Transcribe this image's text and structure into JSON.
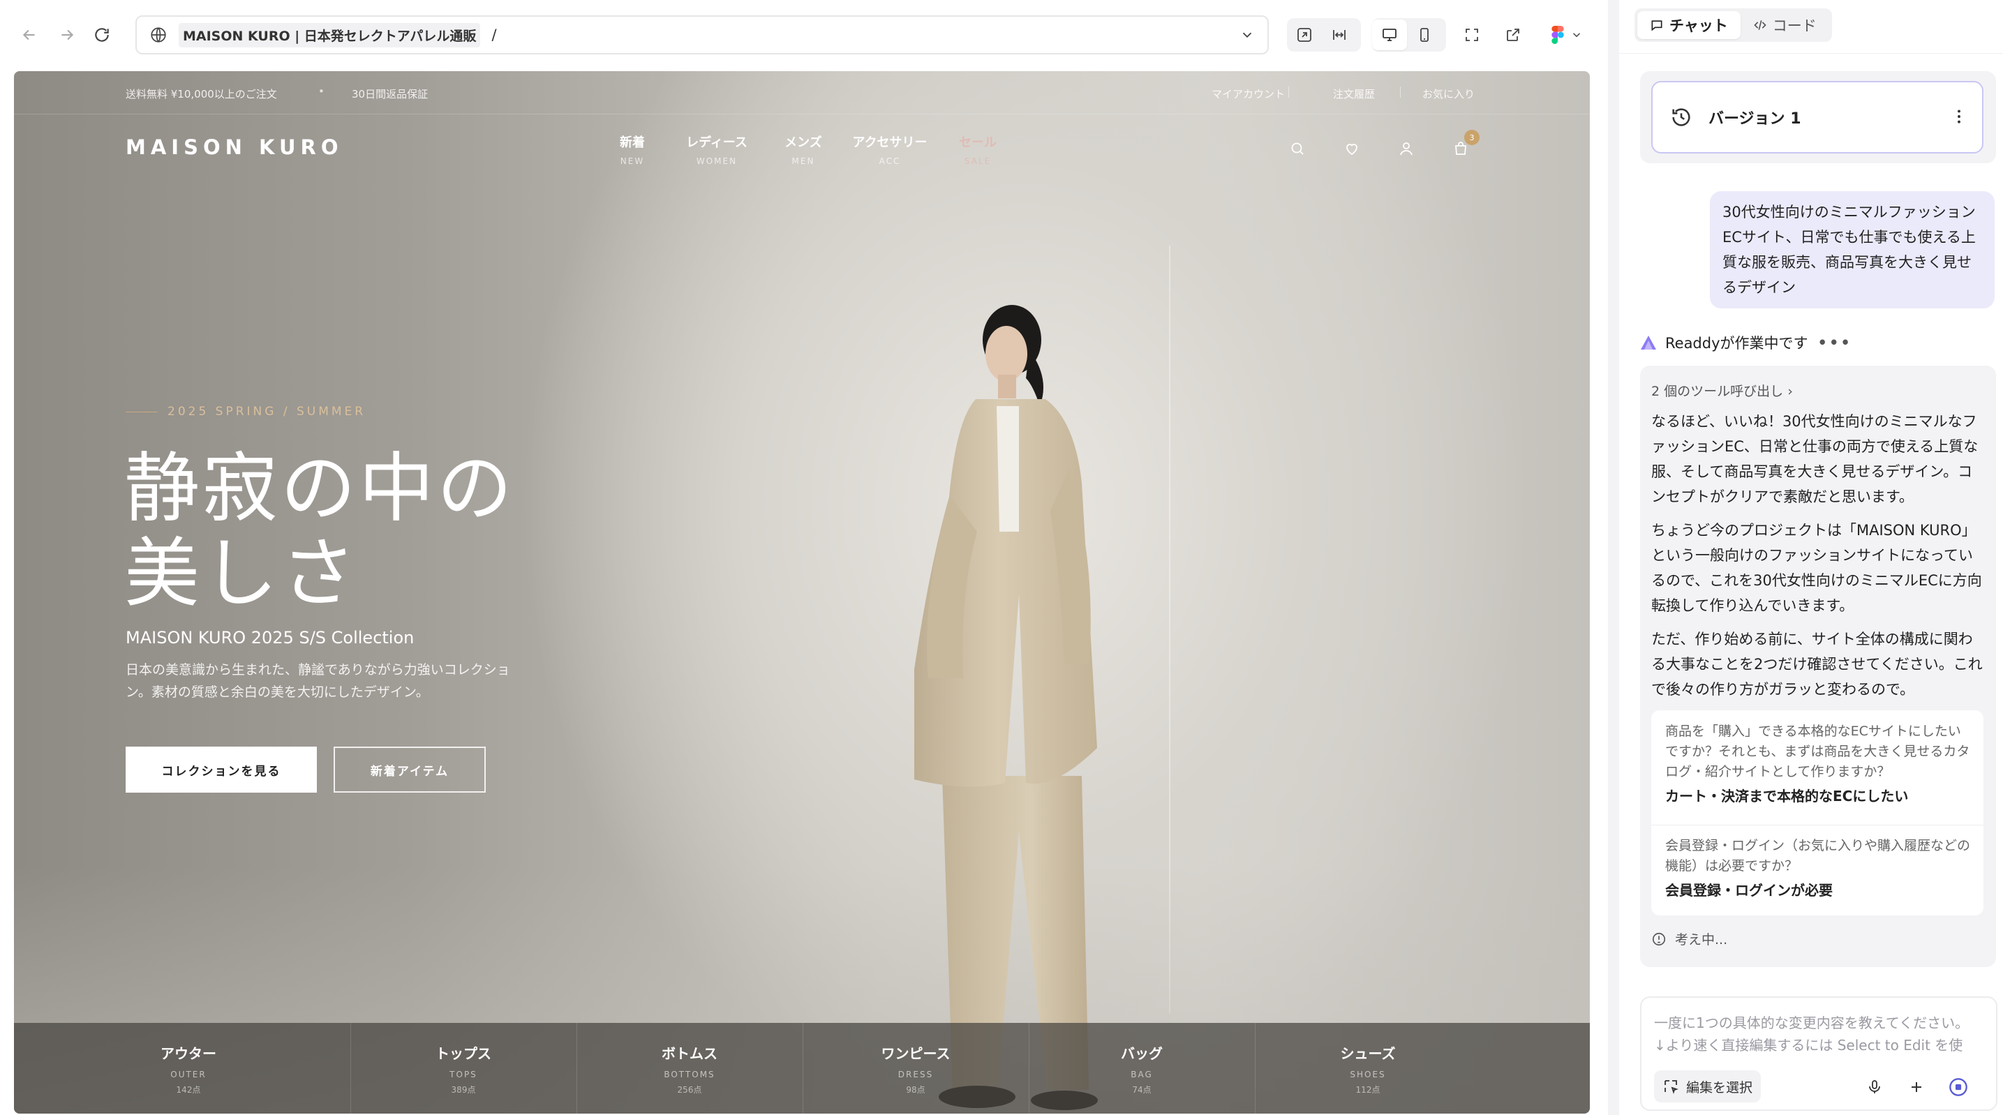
{
  "browser": {
    "url_title": "MAISON KURO | 日本発セレクトアパレル通販",
    "url_path": "/"
  },
  "site": {
    "topbar": {
      "shipping": "送料無料 ¥10,000以上のご注文",
      "returns": "30日間返品保証",
      "account": "マイアカウント",
      "orders": "注文履歴",
      "favorites": "お気に入り"
    },
    "logo": "MAISON KURO",
    "nav": [
      {
        "jp": "新着",
        "en": "NEW"
      },
      {
        "jp": "レディース",
        "en": "WOMEN"
      },
      {
        "jp": "メンズ",
        "en": "MEN"
      },
      {
        "jp": "アクセサリー",
        "en": "ACC"
      },
      {
        "jp": "セール",
        "en": "SALE"
      }
    ],
    "cart_count": "3",
    "hero": {
      "season": "2025 SPRING / SUMMER",
      "title_line1": "静寂の中の",
      "title_line2": "美しさ",
      "subtitle": "MAISON KURO 2025 S/S Collection",
      "description": "日本の美意識から生まれた、静謐でありながら力強いコレクション。素材の質感と余白の美を大切にしたデザイン。",
      "primary_button": "コレクションを見る",
      "secondary_button": "新着アイテム"
    },
    "categories": [
      {
        "jp": "アウター",
        "en": "OUTER",
        "count": "142点"
      },
      {
        "jp": "トップス",
        "en": "TOPS",
        "count": "389点"
      },
      {
        "jp": "ボトムス",
        "en": "BOTTOMS",
        "count": "256点"
      },
      {
        "jp": "ワンピース",
        "en": "DRESS",
        "count": "98点"
      },
      {
        "jp": "バッグ",
        "en": "BAG",
        "count": "74点"
      },
      {
        "jp": "シューズ",
        "en": "SHOES",
        "count": "112点"
      }
    ]
  },
  "panel": {
    "tabs": {
      "chat": "チャット",
      "code": "コード"
    },
    "version_label": "バージョン 1",
    "user_message": "30代女性向けのミニマルファッションECサイト、日常でも仕事でも使える上質な服を販売、商品写真を大きく見せるデザイン",
    "agent_status": "Readdyが作業中です",
    "agent_dots": "•••",
    "tool_calls": "2 個のツール呼び出し",
    "agent_paragraphs": [
      "なるほど、いいね！30代女性向けのミニマルなファッションEC、日常と仕事の両方で使える上質な服、そして商品写真を大きく見せるデザイン。コンセプトがクリアで素敵だと思います。",
      "ちょうど今のプロジェクトは「MAISON KURO」という一般向けのファッションサイトになっているので、これを30代女性向けのミニマルECに方向転換して作り込んでいきます。",
      "ただ、作り始める前に、サイト全体の構成に関わる大事なことを2つだけ確認させてください。これで後々の作り方がガラッと変わるので。"
    ],
    "questions": [
      {
        "q": "商品を「購入」できる本格的なECサイトにしたいですか？それとも、まずは商品を大きく見せるカタログ・紹介サイトとして作りますか？",
        "a": "カート・決済まで本格的なECにしたい"
      },
      {
        "q": "会員登録・ログイン（お気に入りや購入履歴などの機能）は必要ですか？",
        "a": "会員登録・ログインが必要"
      }
    ],
    "thinking": "考え中...",
    "composer_placeholder": "一度に1つの具体的な変更内容を教えてください。\n↓より速く直接編集するには Select to Edit を使",
    "select_button": "編集を選択"
  },
  "colors": {
    "accent": "#5b5bd6",
    "gold": "#c9a36a",
    "sale": "#e9a9a3",
    "user_bubble": "#ebeafb"
  }
}
